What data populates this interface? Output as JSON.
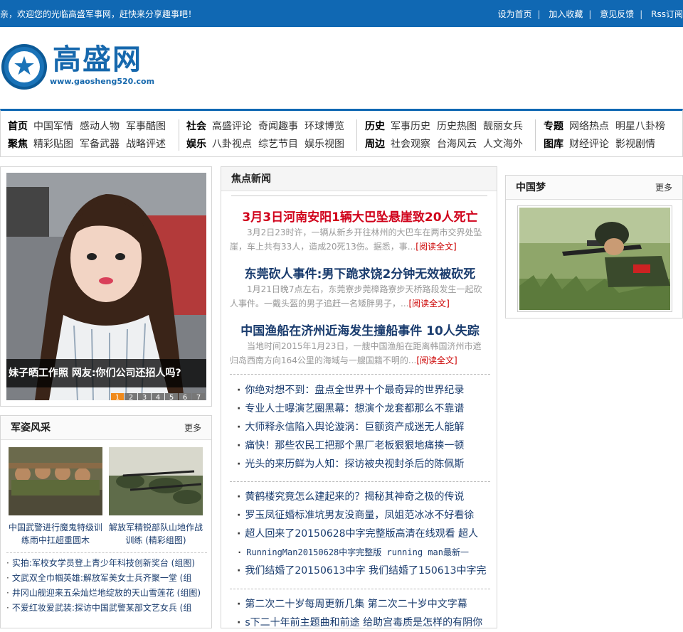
{
  "topbar": {
    "welcome": "亲，欢迎您的光临高盛军事网，赶快来分享趣事吧！",
    "links": [
      "设为首页",
      "加入收藏",
      "意见反馈",
      "Rss订阅"
    ]
  },
  "logo": {
    "name": "高盛网",
    "url": "www.gaosheng520.com"
  },
  "nav": {
    "groups": [
      {
        "rows": [
          {
            "head": "首页",
            "items": [
              "中国军情",
              "感动人物",
              "军事酷图"
            ]
          },
          {
            "head": "聚焦",
            "items": [
              "精彩贴图",
              "军备武器",
              "战略评述"
            ]
          }
        ]
      },
      {
        "rows": [
          {
            "head": "社会",
            "items": [
              "高盛评论",
              "奇闻趣事",
              "环球博览"
            ]
          },
          {
            "head": "娱乐",
            "items": [
              "八卦视点",
              "综艺节目",
              "娱乐视图"
            ]
          }
        ]
      },
      {
        "rows": [
          {
            "head": "历史",
            "items": [
              "军事历史",
              "历史热图",
              "靓丽女兵"
            ]
          },
          {
            "head": "周边",
            "items": [
              "社会观察",
              "台海风云",
              "人文海外"
            ]
          }
        ]
      },
      {
        "rows": [
          {
            "head": "专题",
            "items": [
              "网络热点",
              "明星八卦榜"
            ]
          },
          {
            "head": "图库",
            "items": [
              "财经评论",
              "影视剧情"
            ]
          }
        ]
      }
    ]
  },
  "slider": {
    "caption": "妹子晒工作照 网友:你们公司还招人吗?",
    "pages": [
      "1",
      "2",
      "3",
      "4",
      "5",
      "6",
      "7"
    ],
    "active_page": "1"
  },
  "jzfc": {
    "title": "军姿风采",
    "more": "更多",
    "pics": [
      {
        "title": "中国武警进行魔鬼特级训练雨中扛超重圆木"
      },
      {
        "title": "解放军精锐部队山地作战训练 (精彩组图)"
      }
    ],
    "list": [
      "实拍:军校女学员登上青少年科技创新奖台 (组图)",
      "文武双全巾帼英雄:解放军美女士兵齐聚一堂 (组",
      "井冈山舰迎来五朵灿烂地绽放的天山雪莲花 (组图)",
      "不爱红妆爱武装:探访中国武警某部文艺女兵 (组"
    ]
  },
  "focus": {
    "title": "焦点新闻",
    "articles": [
      {
        "title": "3月3日河南安阳1辆大巴坠悬崖致20人死亡",
        "summary": "3月2日23时许，一辆从新乡开往林州的大巴车在两市交界处坠崖，车上共有33人，造成20死13伤。据悉，事...",
        "read": "[阅读全文]",
        "color": "#d0021b"
      },
      {
        "title": "东莞砍人事件:男下跪求饶2分钟无效被砍死",
        "summary": "1月21日晚7点左右，东莞寮步莞樟路寮步天桥路段发生一起砍人事件。一戴头盔的男子追赶一名矮胖男子，...",
        "read": "[阅读全文]",
        "color": "#1a3c6e"
      },
      {
        "title": "中国渔船在济州近海发生撞船事件 10人失踪",
        "summary": "当地时间2015年1月23日，一艘中国渔船在距离韩国济州市遮归岛西南方向164公里的海域与一艘国籍不明的...",
        "read": "[阅读全文]",
        "color": "#1a3c6e"
      }
    ],
    "list1": [
      "你绝对想不到：盘点全世界十个最奇异的世界纪录",
      "专业人士曝演艺圈黑幕：想演个龙套都那么不靠谱",
      "大师释永信陷入舆论漩涡：巨额资产成迷无人能解",
      "痛快！那些农民工把那个黑厂老板狠狠地痛揍一顿",
      "光头的来历鲜为人知：探访被央视封杀后的陈佩斯"
    ],
    "list2": [
      "黄鹤楼究竟怎么建起来的？揭秘其神奇之极的传说",
      "罗玉凤征婚标准坑男友没商量，凤姐范冰冰不好看徐",
      "超人回来了20150628中字完整版高清在线观看 超人",
      "RunningMan20150628中字完整版 running man最新一",
      "我们结婚了20150613中字 我们结婚了150613中字完"
    ],
    "list3": [
      "第二次二十岁每周更新几集 第二次二十岁中文字幕",
      "s下二十年前主题曲和前途 给助宫毒质是怎样的有阴你"
    ]
  },
  "dream": {
    "title": "中国梦",
    "more": "更多"
  },
  "colors": {
    "brand": "#1068b3",
    "headline_red": "#d0021b",
    "link": "#1a3c6e",
    "pager_active": "#f08a1c"
  }
}
